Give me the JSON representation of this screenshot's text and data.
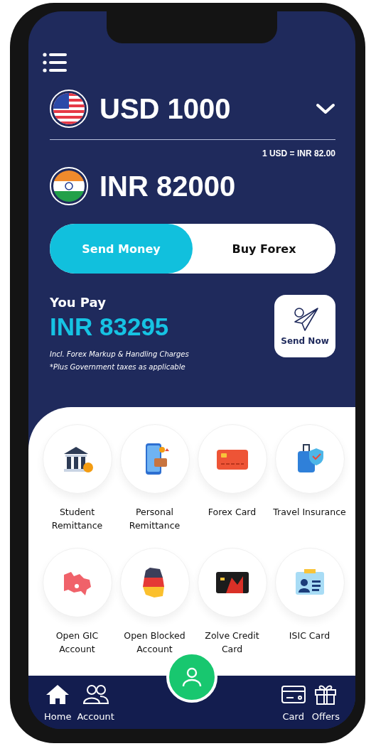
{
  "from": {
    "currency_amount": "USD 1000"
  },
  "rate": "1 USD = INR 82.00",
  "to": {
    "currency_amount": "INR 82000"
  },
  "mode_toggle": [
    {
      "label": "Send Money",
      "selected": true
    },
    {
      "label": "Buy Forex",
      "selected": false
    }
  ],
  "payment": {
    "title": "You Pay",
    "amount": "INR 83295",
    "notes": [
      "Incl. Forex Markup & Handling Charges",
      "*Plus Government taxes as applicable"
    ],
    "send_button": "Send Now"
  },
  "services": [
    {
      "label": "Student Remittance"
    },
    {
      "label": "Personal Remittance"
    },
    {
      "label": "Forex Card"
    },
    {
      "label": "Travel Insurance"
    },
    {
      "label": "Open GIC Account"
    },
    {
      "label": "Open Blocked Account"
    },
    {
      "label": "Zolve Credit Card"
    },
    {
      "label": "ISIC Card"
    }
  ],
  "bottom_nav": [
    {
      "label": "Home"
    },
    {
      "label": "Account"
    },
    {
      "label": "Card"
    },
    {
      "label": "Offers"
    }
  ]
}
